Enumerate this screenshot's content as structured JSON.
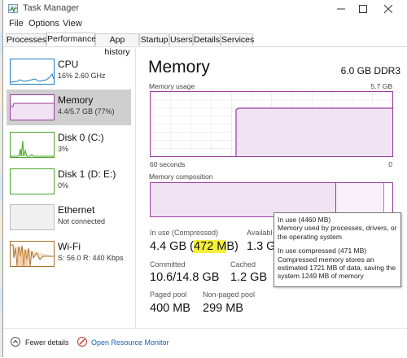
{
  "window": {
    "title": "Task Manager"
  },
  "menu": [
    "File",
    "Options",
    "View"
  ],
  "tabs": [
    "Processes",
    "Performance",
    "App history",
    "Startup",
    "Users",
    "Details",
    "Services"
  ],
  "sidebar": {
    "items": [
      {
        "name": "CPU",
        "sub": "16%  2.60 GHz"
      },
      {
        "name": "Memory",
        "sub": "4.4/5.7 GB (77%)"
      },
      {
        "name": "Disk 0 (C:)",
        "sub": "3%"
      },
      {
        "name": "Disk 1 (D: E:)",
        "sub": "0%"
      },
      {
        "name": "Ethernet",
        "sub": "Not connected"
      },
      {
        "name": "Wi-Fi",
        "sub": "S: 56.0  R: 440 Kbps"
      }
    ]
  },
  "main": {
    "title": "Memory",
    "spec": "6.0 GB DDR3",
    "usage_label": "Memory usage",
    "usage_max": "5.7 GB",
    "axis_left": "60 seconds",
    "axis_right": "0",
    "composition_label": "Memory composition",
    "stats": {
      "in_use_label": "In use (Compressed)",
      "in_use_prefix": "4.4 GB (",
      "in_use_highlight": "472 M",
      "in_use_suffix": "B)",
      "available_label": "Availabl",
      "available_value": "1.3 G",
      "committed_label": "Committed",
      "committed_value": "10.6/14.8 GB",
      "cached_label": "Cached",
      "cached_value": "1.2 GB",
      "paged_label": "Paged pool",
      "paged_value": "400 MB",
      "nonpaged_label": "Non-paged pool",
      "nonpaged_value": "299 MB"
    }
  },
  "tooltip": {
    "line1": "In use (4460 MB)",
    "line2": "Memory used by processes, drivers, or",
    "line3": "the operating system",
    "line4": "In use compressed (471 MB)",
    "line5": "Compressed memory stores an",
    "line6": "estimated 1721 MB of data, saving the",
    "line7": "system 1249 MB of memory"
  },
  "footer": {
    "fewer_details": "Fewer details",
    "open_monitor": "Open Resource Monitor"
  },
  "colors": {
    "memory": "#9a3c9f",
    "cpu": "#1f7bbf",
    "disk": "#4da32a",
    "wifi": "#a8702a",
    "highlight": "#f4ef3a"
  }
}
